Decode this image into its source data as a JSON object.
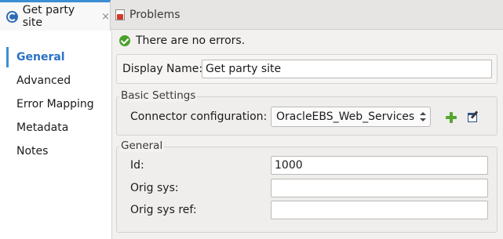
{
  "tabs": {
    "active": {
      "label": "Get party site",
      "close": "×",
      "icon": "mule-connector-icon"
    },
    "inactive": {
      "label": "Problems",
      "icon": "problems-icon"
    }
  },
  "sidebar": {
    "items": [
      {
        "label": "General",
        "active": true
      },
      {
        "label": "Advanced",
        "active": false
      },
      {
        "label": "Error Mapping",
        "active": false
      },
      {
        "label": "Metadata",
        "active": false
      },
      {
        "label": "Notes",
        "active": false
      }
    ]
  },
  "status": {
    "icon": "check-icon",
    "text": "There are no errors."
  },
  "display_name": {
    "label": "Display Name:",
    "value": "Get party site"
  },
  "basic_settings": {
    "title": "Basic Settings",
    "connector_label": "Connector configuration:",
    "connector_value": "OracleEBS_Web_Services",
    "add_icon": "plus-icon",
    "edit_icon": "edit-icon"
  },
  "general": {
    "title": "General",
    "fields": [
      {
        "label": "Id:",
        "value": "1000"
      },
      {
        "label": "Orig sys:",
        "value": ""
      },
      {
        "label": "Orig sys ref:",
        "value": ""
      }
    ]
  },
  "colors": {
    "accent": "#3c8fd4",
    "active_nav": "#2a72c5",
    "success": "#4aa02c",
    "add": "#55a630"
  }
}
